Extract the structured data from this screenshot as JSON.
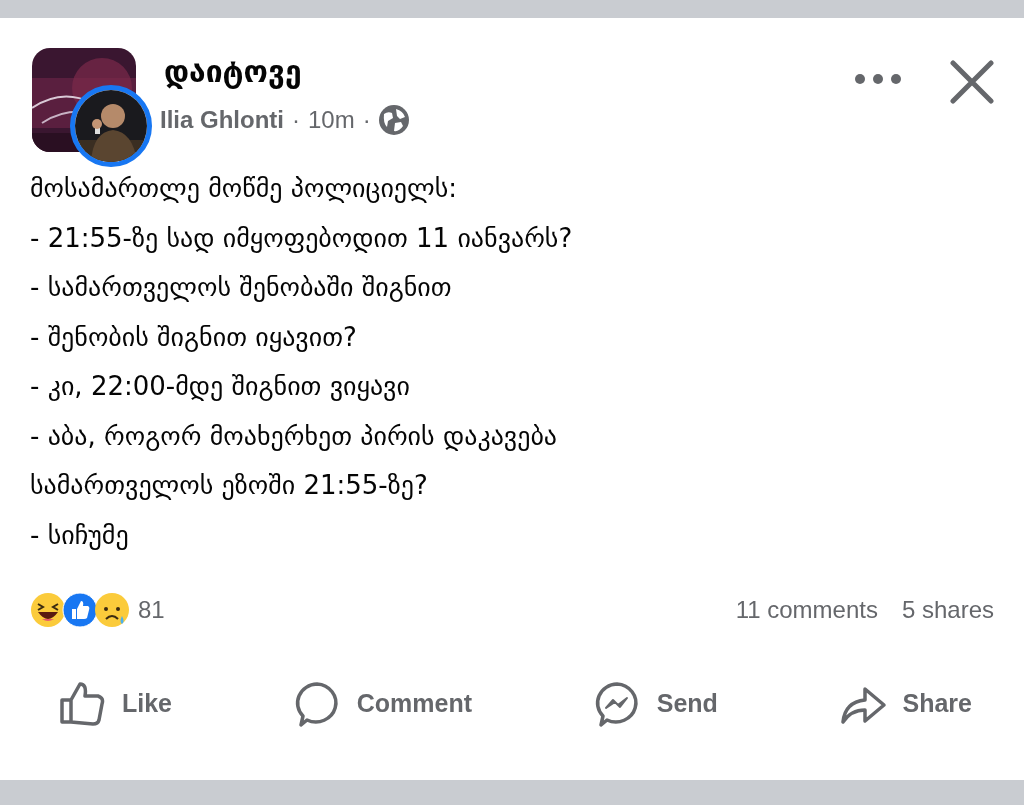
{
  "post": {
    "page_name": "დაიტოვე",
    "author": "Ilia Ghlonti",
    "time": "10m",
    "separators": [
      "·",
      "·"
    ],
    "lines": [
      "მოსამართლე მოწმე პოლიციელს:",
      "- 21:55-ზე სად იმყოფებოდით 11 იანვარს?",
      "- სამართველოს შენობაში შიგნით",
      "- შენობის შიგნით იყავით?",
      "- კი, 22:00-მდე შიგნით ვიყავი",
      "- აბა, როგორ მოახერხეთ პირის დაკავება",
      "სამართველოს ეზოში 21:55-ზე?",
      "- სიჩუმე"
    ],
    "reactions": [
      {
        "kind": "haha"
      },
      {
        "kind": "like"
      },
      {
        "kind": "sad"
      }
    ],
    "reaction_count": "81",
    "comments": "11 comments",
    "shares": "5 shares",
    "actions": [
      {
        "kind": "like",
        "label": "Like"
      },
      {
        "kind": "comment",
        "label": "Comment"
      },
      {
        "kind": "send",
        "label": "Send"
      },
      {
        "kind": "share",
        "label": "Share"
      }
    ]
  }
}
